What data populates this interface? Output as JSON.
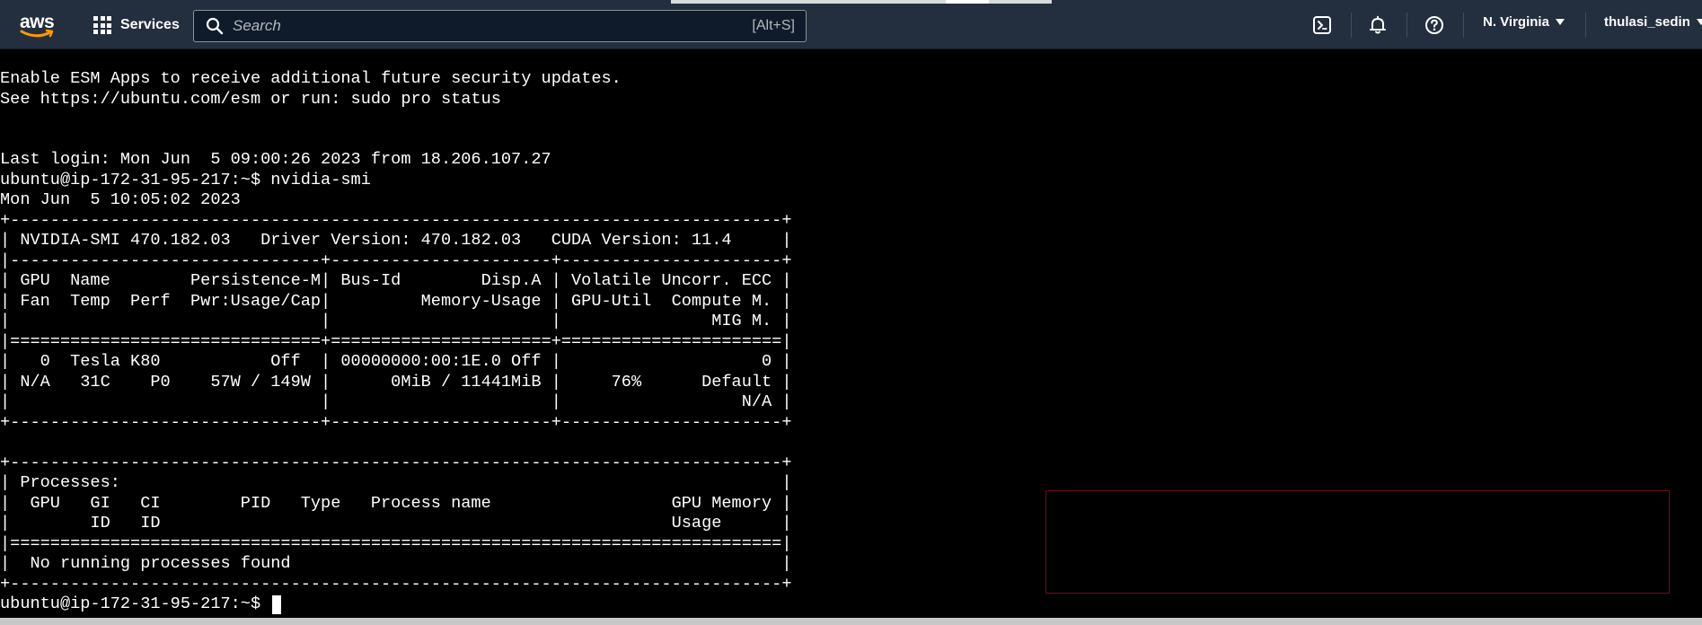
{
  "topbar": {
    "logo_text": "aws",
    "services_label": "Services",
    "search": {
      "placeholder": "Search",
      "shortcut": "[Alt+S]"
    },
    "icons": [
      "cloudshell-icon",
      "bell-icon",
      "help-icon"
    ],
    "region_label": "N. Virginia",
    "account_label": "thulasi_sedin",
    "accent_color": "#ff9900",
    "background_color": "#232f3e"
  },
  "terminal": {
    "lines": [
      "Enable ESM Apps to receive additional future security updates.",
      "See https://ubuntu.com/esm or run: sudo pro status",
      "",
      "",
      "Last login: Mon Jun  5 09:00:26 2023 from 18.206.107.27",
      "ubuntu@ip-172-31-95-217:~$ nvidia-smi",
      "Mon Jun  5 10:05:02 2023",
      "+-----------------------------------------------------------------------------+",
      "| NVIDIA-SMI 470.182.03   Driver Version: 470.182.03   CUDA Version: 11.4     |",
      "|-------------------------------+----------------------+----------------------+",
      "| GPU  Name        Persistence-M| Bus-Id        Disp.A | Volatile Uncorr. ECC |",
      "| Fan  Temp  Perf  Pwr:Usage/Cap|         Memory-Usage | GPU-Util  Compute M. |",
      "|                               |                      |               MIG M. |",
      "|===============================+======================+======================|",
      "|   0  Tesla K80           Off  | 00000000:00:1E.0 Off |                    0 |",
      "| N/A   31C    P0    57W / 149W |      0MiB / 11441MiB |     76%      Default |",
      "|                               |                      |                  N/A |",
      "+-------------------------------+----------------------+----------------------+",
      "",
      "+-----------------------------------------------------------------------------+",
      "| Processes:                                                                  |",
      "|  GPU   GI   CI        PID   Type   Process name                  GPU Memory |",
      "|        ID   ID                                                   Usage      |",
      "|=============================================================================|",
      "|  No running processes found                                                 |",
      "+-----------------------------------------------------------------------------+"
    ],
    "prompt": "ubuntu@ip-172-31-95-217:~$ ",
    "text_color": "#ffffff",
    "background_color": "#000000"
  }
}
